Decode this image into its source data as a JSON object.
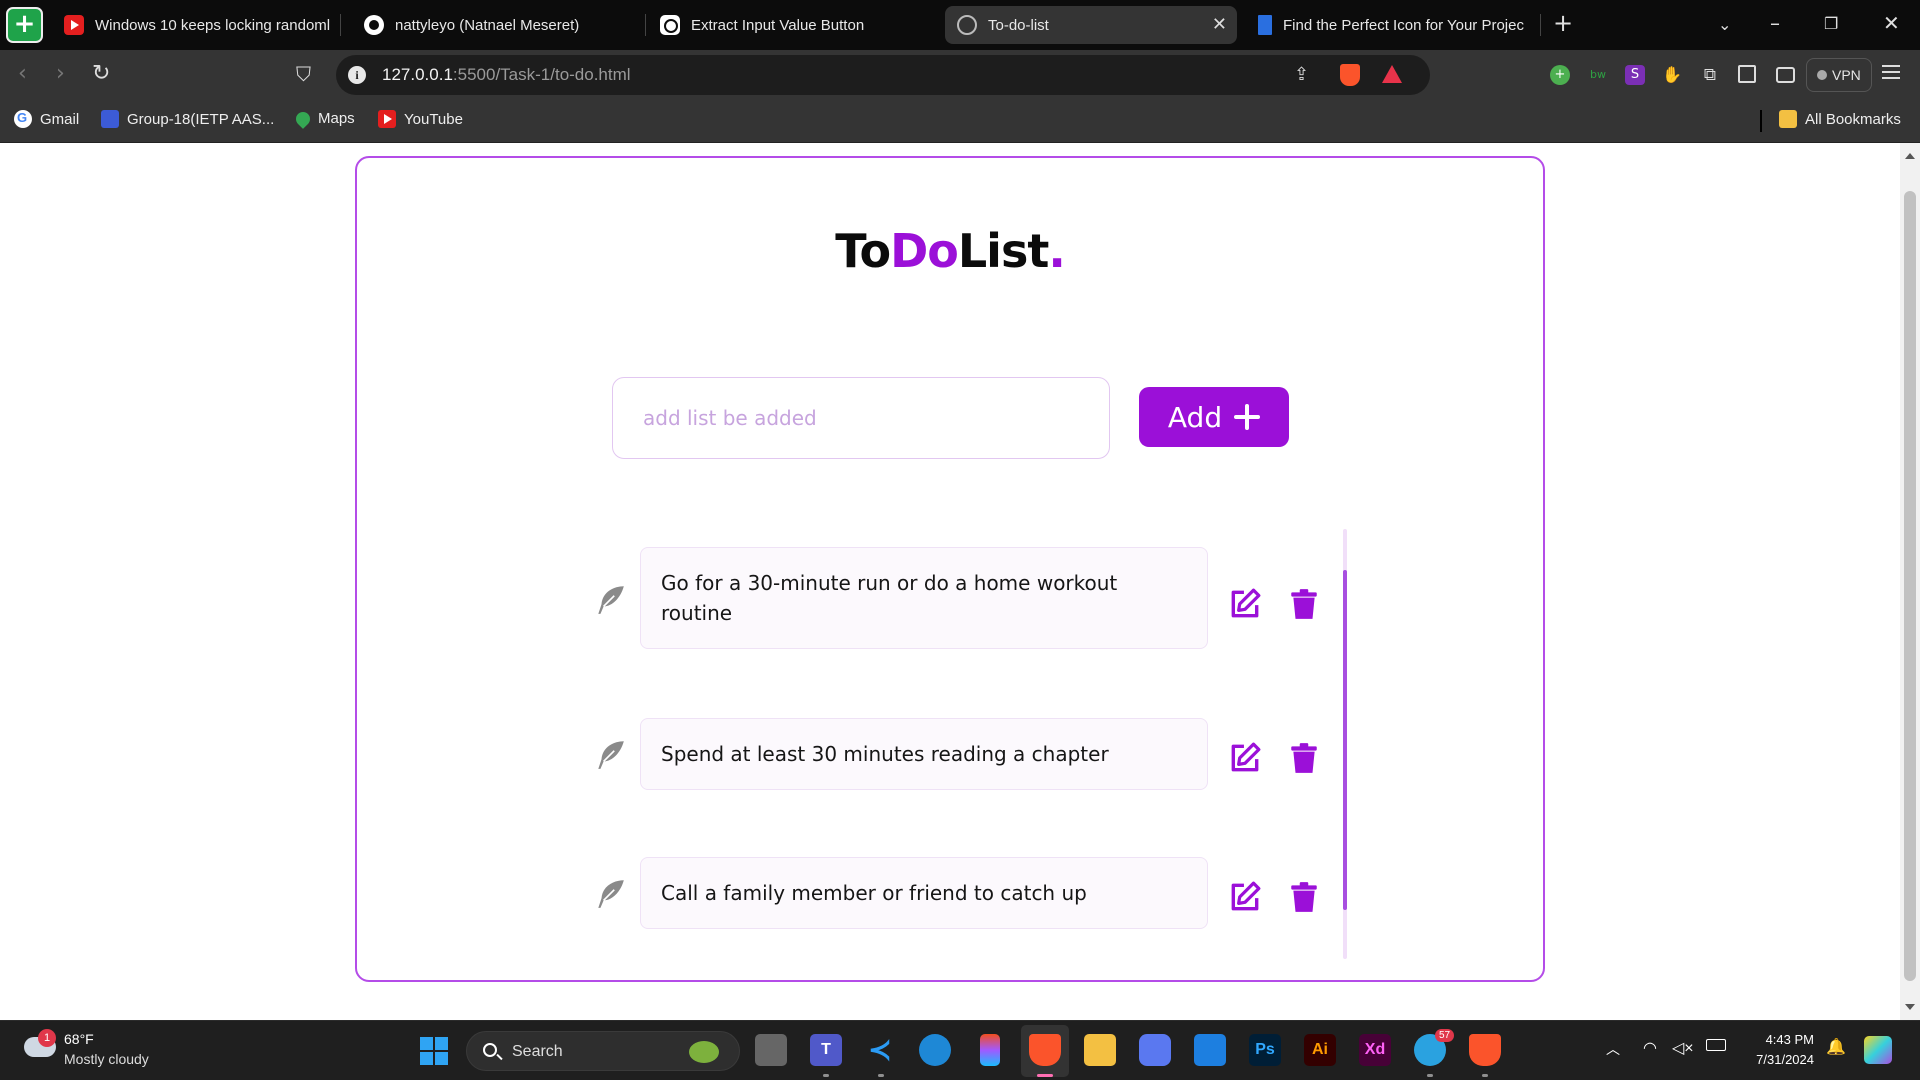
{
  "browser": {
    "tabs": [
      {
        "label": "Windows 10 keeps locking randoml",
        "icon": "youtube-icon",
        "active": false
      },
      {
        "label": "nattyleyo (Natnael Meseret)",
        "icon": "github-icon",
        "active": false
      },
      {
        "label": "Extract Input Value Button",
        "icon": "chatgpt-icon",
        "active": false
      },
      {
        "label": "To-do-list",
        "icon": "globe-icon",
        "active": true
      },
      {
        "label": "Find the Perfect Icon for Your Projec",
        "icon": "flag-icon",
        "active": false
      }
    ],
    "url": {
      "host": "127.0.0.1",
      "path": ":5500/Task-1/to-do.html"
    },
    "vpn_label": "VPN",
    "bookmarks": [
      {
        "label": "Gmail",
        "icon": "google-icon"
      },
      {
        "label": "Group-18(IETP AAS...",
        "icon": "group-icon"
      },
      {
        "label": "Maps",
        "icon": "maps-icon"
      },
      {
        "label": "YouTube",
        "icon": "youtube-icon"
      }
    ],
    "all_bookmarks_label": "All Bookmarks"
  },
  "app": {
    "title": {
      "part1": "To",
      "part2": "Do",
      "part3": "List",
      "dot": "."
    },
    "input": {
      "placeholder": "add list be added",
      "value": ""
    },
    "add_button_label": "Add",
    "items": [
      {
        "text": "Go for a 30-minute run or do a home workout routine"
      },
      {
        "text": "Spend at least 30 minutes reading a chapter"
      },
      {
        "text": "Call a family member or friend to catch up"
      }
    ],
    "colors": {
      "accent": "#9b10d8",
      "border": "#b44ce8",
      "icon_gray": "#8a8a8a"
    }
  },
  "taskbar": {
    "weather": {
      "temp": "68°F",
      "desc": "Mostly cloudy",
      "badge": "1"
    },
    "search_label": "Search",
    "telegram_badge": "57",
    "time": "4:43 PM",
    "date": "7/31/2024"
  }
}
